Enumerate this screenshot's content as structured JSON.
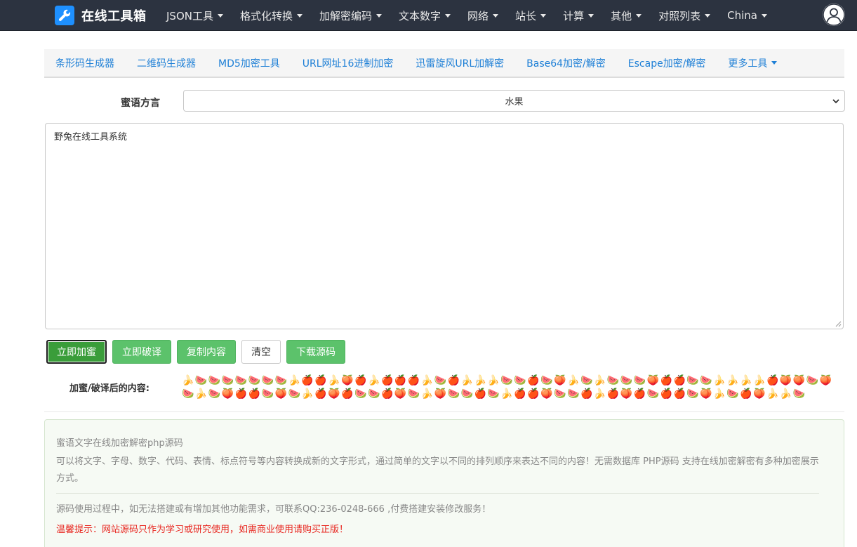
{
  "navbar": {
    "brand": "在线工具箱",
    "items": [
      {
        "label": "JSON工具"
      },
      {
        "label": "格式化转换"
      },
      {
        "label": "加解密编码"
      },
      {
        "label": "文本数字"
      },
      {
        "label": "网络"
      },
      {
        "label": "站长"
      },
      {
        "label": "计算"
      },
      {
        "label": "其他"
      },
      {
        "label": "对照列表"
      },
      {
        "label": "China"
      }
    ]
  },
  "subnav": {
    "items": [
      {
        "label": "条形码生成器"
      },
      {
        "label": "二维码生成器"
      },
      {
        "label": "MD5加密工具"
      },
      {
        "label": "URL网址16进制加密"
      },
      {
        "label": "迅雷旋风URL加解密"
      },
      {
        "label": "Base64加密/解密"
      },
      {
        "label": "Escape加密/解密"
      }
    ],
    "more": "更多工具"
  },
  "form": {
    "dialect_label": "蜜语方言",
    "dialect_value": "水果",
    "input_text": "野兔在线工具系统"
  },
  "buttons": {
    "encrypt": "立即加蜜",
    "decrypt": "立即破译",
    "copy": "复制内容",
    "clear": "清空",
    "download": "下载源码"
  },
  "result": {
    "label": "加蜜/破译后的内容:",
    "content": "🍌🍉🍉🍉🍉🍉🍉🍉🍌🍎🍎🍌🍑🍎🍌🍎🍎🍎🍌🍉🍎🍌🍌🍌🍉🍉🍎🍉🍑🍌🍉🍌🍉🍉🍉🍑🍎🍎🍉🍉🍌🍌🍌🍌🍎🍑🍑🍉🍑🍉🍌🍉🍑🍎🍎🍉🍑🍉🍌🍎🍑🍎🍉🍉🍎🍑🍉🍌🍑🍉🍉🍎🍉🍌🍎🍎🍑🍉🍉🍎🍌🍎🍑🍎🍉🍎🍎🍉🍑🍌🍉🍎🍑🍌🍌🍉"
  },
  "info": {
    "title": "蜜语文字在线加密解密php源码",
    "body": "可以将文字、字母、数字、代码、表情、标点符号等内容转换成新的文字形式，通过简单的文字以不同的排列顺序来表达不同的内容！无需数据库 PHP源码 支持在线加密解密有多种加密展示方式。",
    "contact": "源码使用过程中，如无法搭建或有增加其他功能需求，可联系QQ:236-0248-666 ,付费搭建安装修改服务！",
    "warning": "温馨提示：网站源码只作为学习或研究使用，如需商业使用请购买正版！"
  },
  "icons": {
    "brand": "wrench-icon",
    "avatar": "user-avatar-icon",
    "select_arrow": "chevron-down-icon"
  },
  "colors": {
    "navbar_bg": "#2c3340",
    "link": "#1d7fd6",
    "button_green": "#5cc26b",
    "warning": "#e8261f"
  }
}
